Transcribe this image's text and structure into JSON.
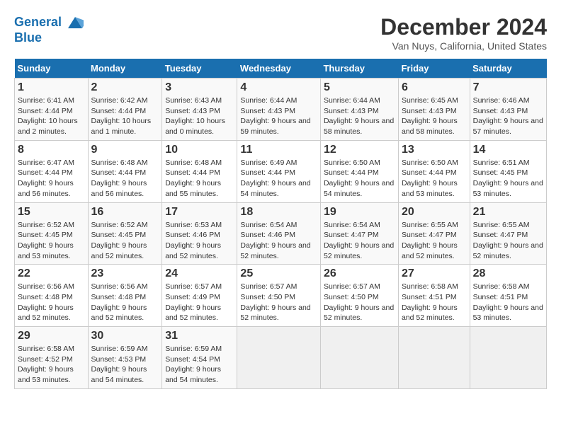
{
  "logo": {
    "line1": "General",
    "line2": "Blue"
  },
  "title": "December 2024",
  "subtitle": "Van Nuys, California, United States",
  "days_of_week": [
    "Sunday",
    "Monday",
    "Tuesday",
    "Wednesday",
    "Thursday",
    "Friday",
    "Saturday"
  ],
  "weeks": [
    [
      {
        "day": "1",
        "sunrise": "Sunrise: 6:41 AM",
        "sunset": "Sunset: 4:44 PM",
        "daylight": "Daylight: 10 hours and 2 minutes."
      },
      {
        "day": "2",
        "sunrise": "Sunrise: 6:42 AM",
        "sunset": "Sunset: 4:44 PM",
        "daylight": "Daylight: 10 hours and 1 minute."
      },
      {
        "day": "3",
        "sunrise": "Sunrise: 6:43 AM",
        "sunset": "Sunset: 4:43 PM",
        "daylight": "Daylight: 10 hours and 0 minutes."
      },
      {
        "day": "4",
        "sunrise": "Sunrise: 6:44 AM",
        "sunset": "Sunset: 4:43 PM",
        "daylight": "Daylight: 9 hours and 59 minutes."
      },
      {
        "day": "5",
        "sunrise": "Sunrise: 6:44 AM",
        "sunset": "Sunset: 4:43 PM",
        "daylight": "Daylight: 9 hours and 58 minutes."
      },
      {
        "day": "6",
        "sunrise": "Sunrise: 6:45 AM",
        "sunset": "Sunset: 4:43 PM",
        "daylight": "Daylight: 9 hours and 58 minutes."
      },
      {
        "day": "7",
        "sunrise": "Sunrise: 6:46 AM",
        "sunset": "Sunset: 4:43 PM",
        "daylight": "Daylight: 9 hours and 57 minutes."
      }
    ],
    [
      {
        "day": "8",
        "sunrise": "Sunrise: 6:47 AM",
        "sunset": "Sunset: 4:44 PM",
        "daylight": "Daylight: 9 hours and 56 minutes."
      },
      {
        "day": "9",
        "sunrise": "Sunrise: 6:48 AM",
        "sunset": "Sunset: 4:44 PM",
        "daylight": "Daylight: 9 hours and 56 minutes."
      },
      {
        "day": "10",
        "sunrise": "Sunrise: 6:48 AM",
        "sunset": "Sunset: 4:44 PM",
        "daylight": "Daylight: 9 hours and 55 minutes."
      },
      {
        "day": "11",
        "sunrise": "Sunrise: 6:49 AM",
        "sunset": "Sunset: 4:44 PM",
        "daylight": "Daylight: 9 hours and 54 minutes."
      },
      {
        "day": "12",
        "sunrise": "Sunrise: 6:50 AM",
        "sunset": "Sunset: 4:44 PM",
        "daylight": "Daylight: 9 hours and 54 minutes."
      },
      {
        "day": "13",
        "sunrise": "Sunrise: 6:50 AM",
        "sunset": "Sunset: 4:44 PM",
        "daylight": "Daylight: 9 hours and 53 minutes."
      },
      {
        "day": "14",
        "sunrise": "Sunrise: 6:51 AM",
        "sunset": "Sunset: 4:45 PM",
        "daylight": "Daylight: 9 hours and 53 minutes."
      }
    ],
    [
      {
        "day": "15",
        "sunrise": "Sunrise: 6:52 AM",
        "sunset": "Sunset: 4:45 PM",
        "daylight": "Daylight: 9 hours and 53 minutes."
      },
      {
        "day": "16",
        "sunrise": "Sunrise: 6:52 AM",
        "sunset": "Sunset: 4:45 PM",
        "daylight": "Daylight: 9 hours and 52 minutes."
      },
      {
        "day": "17",
        "sunrise": "Sunrise: 6:53 AM",
        "sunset": "Sunset: 4:46 PM",
        "daylight": "Daylight: 9 hours and 52 minutes."
      },
      {
        "day": "18",
        "sunrise": "Sunrise: 6:54 AM",
        "sunset": "Sunset: 4:46 PM",
        "daylight": "Daylight: 9 hours and 52 minutes."
      },
      {
        "day": "19",
        "sunrise": "Sunrise: 6:54 AM",
        "sunset": "Sunset: 4:47 PM",
        "daylight": "Daylight: 9 hours and 52 minutes."
      },
      {
        "day": "20",
        "sunrise": "Sunrise: 6:55 AM",
        "sunset": "Sunset: 4:47 PM",
        "daylight": "Daylight: 9 hours and 52 minutes."
      },
      {
        "day": "21",
        "sunrise": "Sunrise: 6:55 AM",
        "sunset": "Sunset: 4:47 PM",
        "daylight": "Daylight: 9 hours and 52 minutes."
      }
    ],
    [
      {
        "day": "22",
        "sunrise": "Sunrise: 6:56 AM",
        "sunset": "Sunset: 4:48 PM",
        "daylight": "Daylight: 9 hours and 52 minutes."
      },
      {
        "day": "23",
        "sunrise": "Sunrise: 6:56 AM",
        "sunset": "Sunset: 4:48 PM",
        "daylight": "Daylight: 9 hours and 52 minutes."
      },
      {
        "day": "24",
        "sunrise": "Sunrise: 6:57 AM",
        "sunset": "Sunset: 4:49 PM",
        "daylight": "Daylight: 9 hours and 52 minutes."
      },
      {
        "day": "25",
        "sunrise": "Sunrise: 6:57 AM",
        "sunset": "Sunset: 4:50 PM",
        "daylight": "Daylight: 9 hours and 52 minutes."
      },
      {
        "day": "26",
        "sunrise": "Sunrise: 6:57 AM",
        "sunset": "Sunset: 4:50 PM",
        "daylight": "Daylight: 9 hours and 52 minutes."
      },
      {
        "day": "27",
        "sunrise": "Sunrise: 6:58 AM",
        "sunset": "Sunset: 4:51 PM",
        "daylight": "Daylight: 9 hours and 52 minutes."
      },
      {
        "day": "28",
        "sunrise": "Sunrise: 6:58 AM",
        "sunset": "Sunset: 4:51 PM",
        "daylight": "Daylight: 9 hours and 53 minutes."
      }
    ],
    [
      {
        "day": "29",
        "sunrise": "Sunrise: 6:58 AM",
        "sunset": "Sunset: 4:52 PM",
        "daylight": "Daylight: 9 hours and 53 minutes."
      },
      {
        "day": "30",
        "sunrise": "Sunrise: 6:59 AM",
        "sunset": "Sunset: 4:53 PM",
        "daylight": "Daylight: 9 hours and 54 minutes."
      },
      {
        "day": "31",
        "sunrise": "Sunrise: 6:59 AM",
        "sunset": "Sunset: 4:54 PM",
        "daylight": "Daylight: 9 hours and 54 minutes."
      },
      null,
      null,
      null,
      null
    ]
  ]
}
